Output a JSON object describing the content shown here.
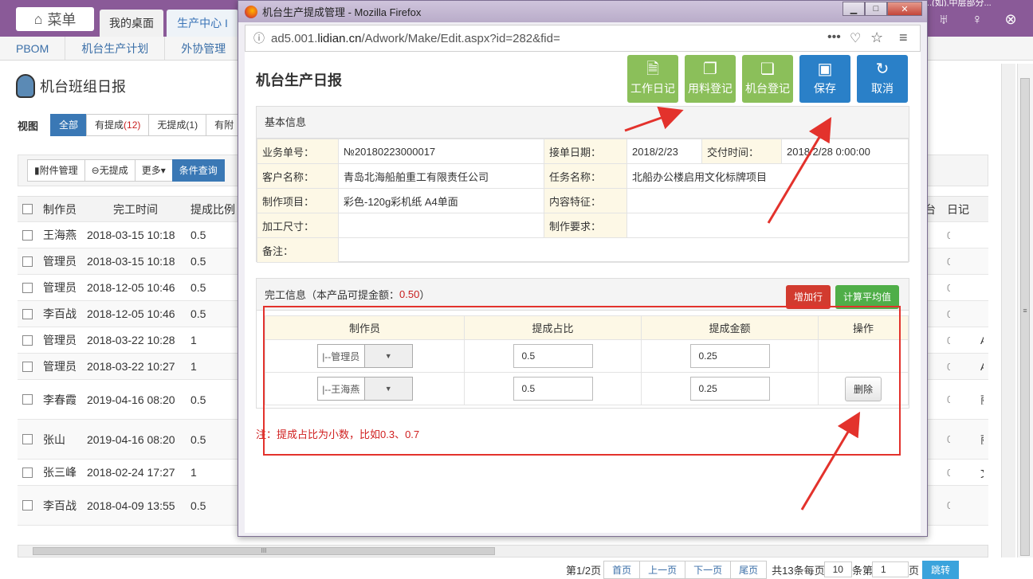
{
  "background": {
    "menu_label": "菜单",
    "tabs": [
      {
        "label": "我的桌面"
      },
      {
        "label": "生产中心 I"
      }
    ],
    "top_text": "...(如),中层部分...",
    "nav": [
      "PBOM",
      "机台生产计划",
      "外协管理"
    ],
    "page_title": "机台班组日报",
    "view_label": "视图",
    "view_buttons": {
      "all": "全部",
      "has_prefix": "有提成",
      "has_count": "(12)",
      "none_prefix": "无提成",
      "none_count": "(1)",
      "more": "有附"
    },
    "toolbar": {
      "attach": "附件管理",
      "no_commission": "无提成",
      "more": "更多▾",
      "query": "条件查询"
    },
    "table_headers": {
      "maker": "制作员",
      "time": "完工时间",
      "ratio": "提成比例",
      "tai": "台",
      "diary": "日记"
    },
    "rows": [
      {
        "name": "王海燕",
        "time": "2018-03-15 10:18",
        "ratio": "0.5",
        "diary": "0",
        "extra": ""
      },
      {
        "name": "管理员",
        "time": "2018-03-15 10:18",
        "ratio": "0.5",
        "diary": "0",
        "extra": ""
      },
      {
        "name": "管理员",
        "time": "2018-12-05 10:46",
        "ratio": "0.5",
        "diary": "0",
        "extra": ""
      },
      {
        "name": "李百战",
        "time": "2018-12-05 10:46",
        "ratio": "0.5",
        "diary": "0",
        "extra": ""
      },
      {
        "name": "管理员",
        "time": "2018-03-22 10:28",
        "ratio": "1",
        "diary": "0",
        "extra": "AV"
      },
      {
        "name": "管理员",
        "time": "2018-03-22 10:27",
        "ratio": "1",
        "diary": "0",
        "extra": "AV"
      },
      {
        "name": "李春霞",
        "time": "2019-04-16 08:20",
        "ratio": "0.5",
        "diary": "0",
        "extra": "丽"
      },
      {
        "name": "张山",
        "time": "2019-04-16 08:20",
        "ratio": "0.5",
        "diary": "0",
        "extra": "丽"
      },
      {
        "name": "张三峰",
        "time": "2018-02-24 17:27",
        "ratio": "1",
        "diary": "0",
        "extra": "文"
      },
      {
        "name": "李百战",
        "time": "2018-04-09 13:55",
        "ratio": "0.5",
        "diary": "0",
        "extra": ""
      }
    ],
    "pager": {
      "page_info": "第1/2页",
      "first": "首页",
      "prev": "上一页",
      "next": "下一页",
      "last": "尾页",
      "total": "共13条每页",
      "per_page": "10",
      "per_unit": "条第",
      "page_no": "1",
      "page_unit": "页",
      "go": "跳转"
    },
    "scroll_mark": "III",
    "scroll_mark_v": "≡"
  },
  "popup": {
    "window_title": "机台生产提成管理 - Mozilla Firefox",
    "url_prefix": "ad5.001.",
    "url_domain": "lidian.cn",
    "url_path": "/Adwork/Make/Edit.aspx?id=282&fid=",
    "form_title": "机台生产日报",
    "buttons": {
      "diary": "工作日记",
      "material": "用料登记",
      "machine": "机台登记",
      "save": "保存",
      "cancel": "取消"
    },
    "basic": {
      "header": "基本信息",
      "labels": {
        "order_no": "业务单号：",
        "receive_date": "接单日期：",
        "delivery_time": "交付时间：",
        "customer": "客户名称：",
        "task": "任务名称：",
        "project": "制作项目：",
        "content": "内容特征：",
        "size": "加工尺寸：",
        "requirement": "制作要求：",
        "remark": "备注："
      },
      "values": {
        "order_no": "№20180223000017",
        "receive_date": "2018/2/23",
        "delivery_time": "2018/2/28 0:00:00",
        "customer": "青岛北海船舶重工有限责任公司",
        "task": "北船办公楼启用文化标牌项目",
        "project": "彩色-120g彩机纸 A4单面",
        "content": "",
        "size": "",
        "requirement": "",
        "remark": ""
      }
    },
    "completion": {
      "header_prefix": "完工信息（本产品可提金额：",
      "amount": "0.50",
      "header_suffix": "）",
      "add_row": "增加行",
      "calc_avg": "计算平均值",
      "columns": {
        "maker": "制作员",
        "ratio": "提成占比",
        "amount": "提成金额",
        "action": "操作"
      },
      "rows": [
        {
          "maker": "|--管理员",
          "ratio": "0.5",
          "amount": "0.25",
          "action": ""
        },
        {
          "maker": "|--王海燕",
          "ratio": "0.5",
          "amount": "0.25",
          "action": "删除"
        }
      ],
      "note": "注：提成占比为小数，比如0.3、0.7"
    }
  }
}
